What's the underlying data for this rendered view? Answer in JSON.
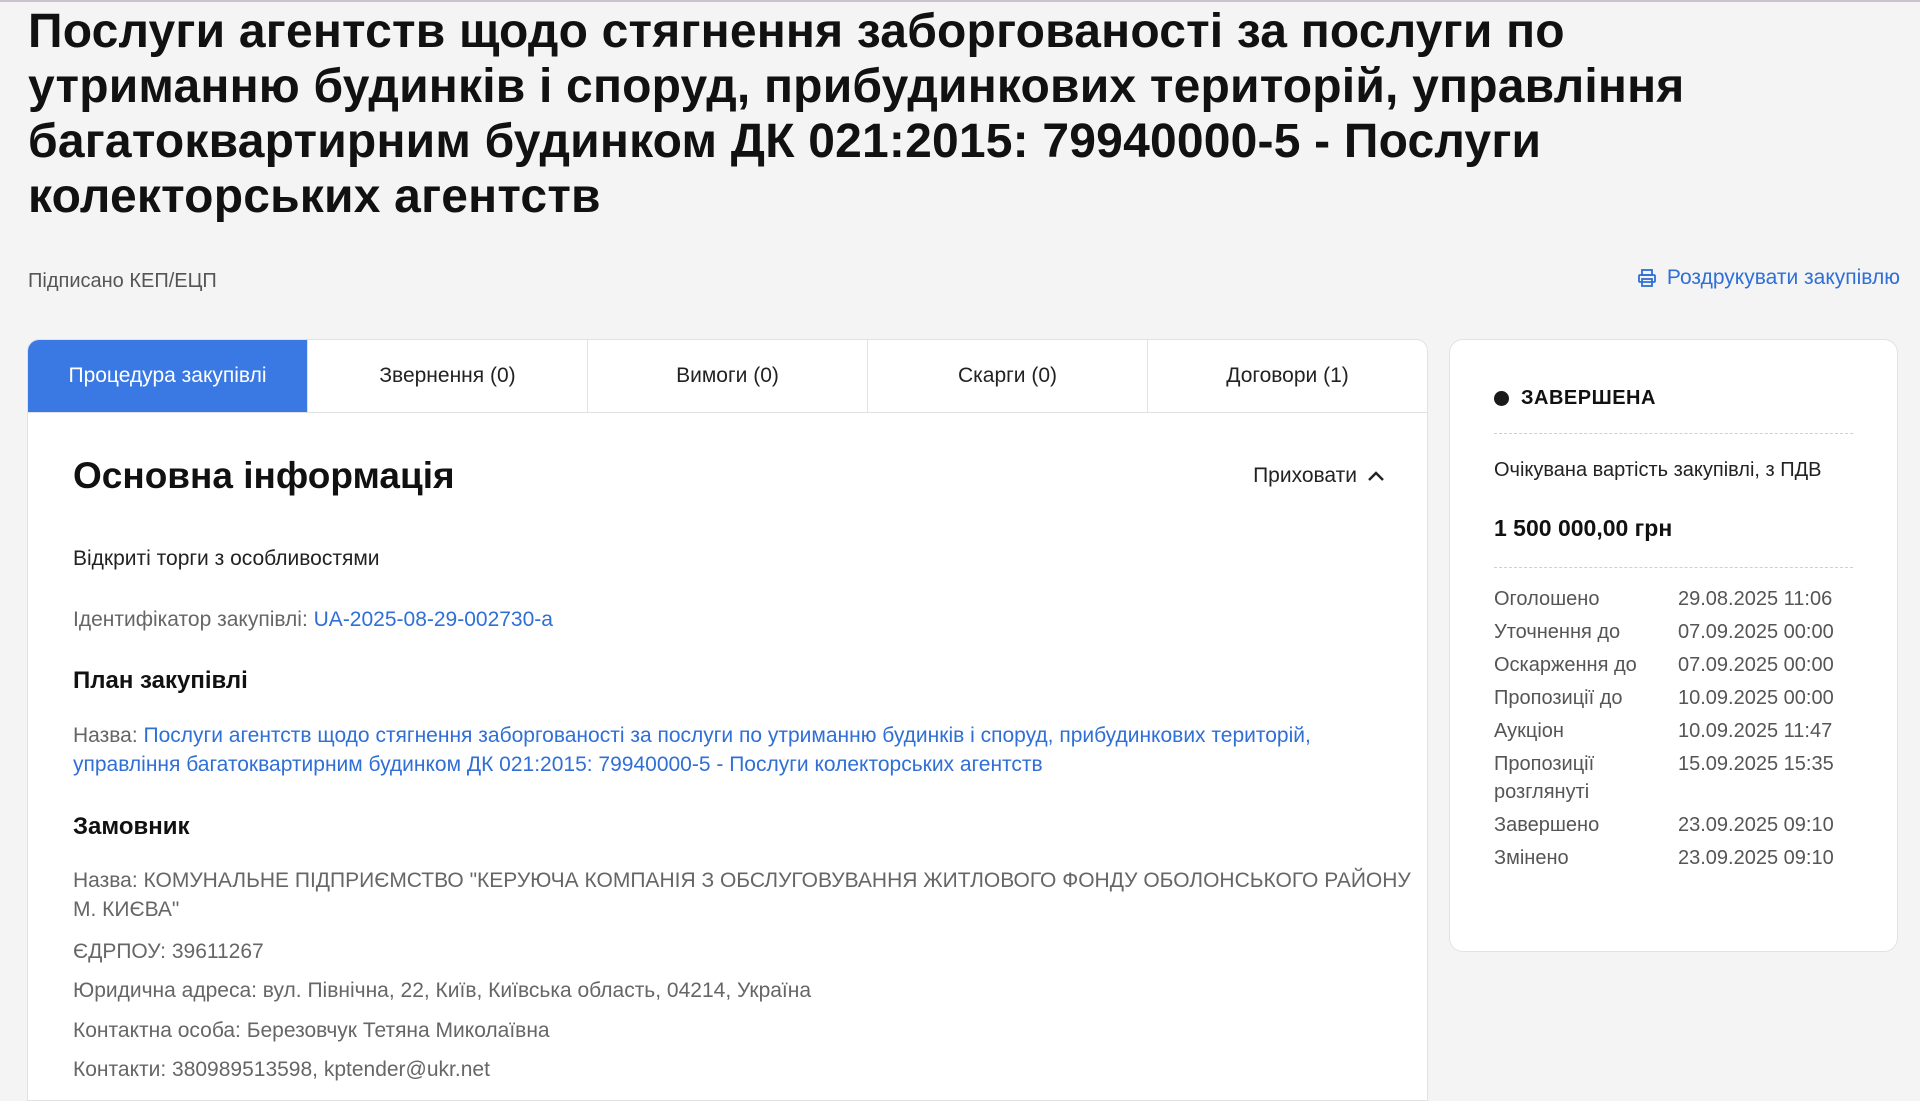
{
  "page": {
    "title": "Послуги агентств щодо стягнення заборгованості за послуги по утриманню будинків і споруд, прибудинкових територій, управління багатоквартирним будинком ДК 021:2015: 79940000-5 - Послуги колекторських агентств",
    "signed": "Підписано КЕП/ЕЦП",
    "print_label": "Роздрукувати закупівлю"
  },
  "tabs": [
    {
      "label": "Процедура закупівлі"
    },
    {
      "label": "Звернення (0)"
    },
    {
      "label": "Вимоги (0)"
    },
    {
      "label": "Скарги (0)"
    },
    {
      "label": "Договори (1)"
    }
  ],
  "main": {
    "section_title": "Основна інформація",
    "hide_label": "Приховати",
    "procedure_type": "Відкриті торги з особливостями",
    "id_label": "Ідентифікатор закупівлі:",
    "id_value": "UA-2025-08-29-002730-a",
    "plan_title": "План закупівлі",
    "plan_name_label": "Назва:",
    "plan_name_value": "Послуги агентств щодо стягнення заборгованості за послуги по утриманню будинків і споруд, прибудинкових територій, управління багатоквартирним будинком ДК 021:2015: 79940000-5 - Послуги колекторських агентств",
    "customer_title": "Замовник",
    "customer_name": "Назва: КОМУНАЛЬНЕ ПІДПРИЄМСТВО \"КЕРУЮЧА КОМПАНІЯ З ОБСЛУГОВУВАННЯ ЖИТЛОВОГО ФОНДУ ОБОЛОНСЬКОГО РАЙОНУ М. КИЄВА\"",
    "customer_edrpou": "ЄДРПОУ: 39611267",
    "customer_address": "Юридична адреса: вул. Північна, 22, Київ, Київська область, 04214, Україна",
    "customer_contact": "Контактна особа: Березовчук Тетяна Миколаївна",
    "customer_contacts": "Контакти: 380989513598, kptender@ukr.net"
  },
  "status": {
    "label": "ЗАВЕРШЕНА",
    "expected_label": "Очікувана вартість закупівлі, з ПДВ",
    "expected_value": "1 500 000,00 грн",
    "dates": [
      {
        "label": "Оголошено",
        "value": "29.08.2025 11:06"
      },
      {
        "label": "Уточнення до",
        "value": "07.09.2025 00:00"
      },
      {
        "label": "Оскарження до",
        "value": "07.09.2025 00:00"
      },
      {
        "label": "Пропозиції до",
        "value": "10.09.2025 00:00"
      },
      {
        "label": "Аукціон",
        "value": "10.09.2025 11:47"
      },
      {
        "label": "Пропозиції розглянуті",
        "value": "15.09.2025 15:35"
      },
      {
        "label": "Завершено",
        "value": "23.09.2025 09:10"
      },
      {
        "label": "Змінено",
        "value": "23.09.2025 09:10"
      }
    ]
  },
  "icons": {
    "print": "printer-icon",
    "hide": "chevron-up-icon"
  },
  "colors": {
    "accent": "#3a79e4",
    "link": "#2f6fd6",
    "background": "#f4f4f4"
  }
}
